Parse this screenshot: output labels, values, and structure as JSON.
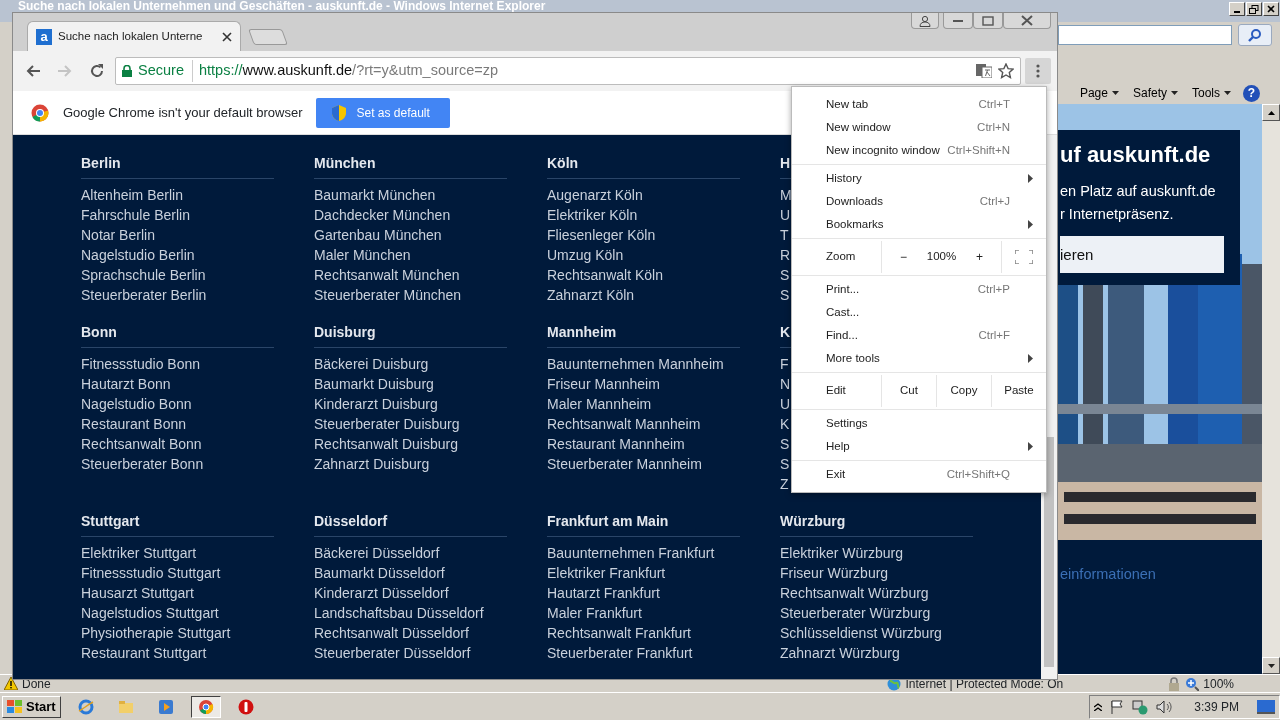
{
  "ie_window": {
    "title": "Suche nach lokalen Unternehmen und Geschäften - auskunft.de - Windows Internet Explorer",
    "command_bar": [
      "Page",
      "Safety",
      "Tools"
    ],
    "help": "?",
    "page": {
      "heading": "uf auskunft.de",
      "text_lines": [
        "en Platz auf auskunft.de",
        "r Internetpräsenz."
      ],
      "button": "ieren",
      "link": "einformationen"
    },
    "status_bar": {
      "text": "Done",
      "zone": "Internet | Protected Mode: On",
      "zoom": "100%"
    }
  },
  "chrome_window": {
    "tab": {
      "favicon_letter": "a",
      "title": "Suche nach lokalen Unterne"
    },
    "address": {
      "security": "Secure",
      "scheme": "https://",
      "host": "www.auskunft.de",
      "path": "/?rt=y&utm_source=zp"
    },
    "infobar": {
      "text": "Google Chrome isn't your default browser",
      "button": "Set as default"
    },
    "cities": [
      {
        "name": "Berlin",
        "links": [
          "Altenheim Berlin",
          "Fahrschule Berlin",
          "Notar Berlin",
          "Nagelstudio Berlin",
          "Sprachschule Berlin",
          "Steuerberater Berlin"
        ]
      },
      {
        "name": "München",
        "links": [
          "Baumarkt München",
          "Dachdecker München",
          "Gartenbau München",
          "Maler München",
          "Rechtsanwalt München",
          "Steuerberater München"
        ]
      },
      {
        "name": "Köln",
        "links": [
          "Augenarzt Köln",
          "Elektriker Köln",
          "Fliesenleger Köln",
          "Umzug Köln",
          "Rechtsanwalt Köln",
          "Zahnarzt Köln"
        ]
      },
      {
        "name": "H",
        "links": [
          "M",
          "U",
          "T",
          "R",
          "S",
          "S"
        ]
      },
      {
        "name": "Bonn",
        "links": [
          "Fitnessstudio Bonn",
          "Hautarzt Bonn",
          "Nagelstudio Bonn",
          "Restaurant Bonn",
          "Rechtsanwalt Bonn",
          "Steuerberater Bonn"
        ]
      },
      {
        "name": "Duisburg",
        "links": [
          "Bäckerei Duisburg",
          "Baumarkt Duisburg",
          "Kinderarzt Duisburg",
          "Steuerberater Duisburg",
          "Rechtsanwalt Duisburg",
          "Zahnarzt Duisburg"
        ]
      },
      {
        "name": "Mannheim",
        "links": [
          "Bauunternehmen Mannheim",
          "Friseur Mannheim",
          "Maler Mannheim",
          "Rechtsanwalt Mannheim",
          "Restaurant Mannheim",
          "Steuerberater Mannheim"
        ]
      },
      {
        "name": "K",
        "links": [
          "F",
          "N",
          "U",
          "K",
          "S",
          "S",
          "Z"
        ]
      },
      {
        "name": "Stuttgart",
        "links": [
          "Elektriker Stuttgart",
          "Fitnessstudio Stuttgart",
          "Hausarzt Stuttgart",
          "Nagelstudios Stuttgart",
          "Physiotherapie Stuttgart",
          "Restaurant Stuttgart"
        ]
      },
      {
        "name": "Düsseldorf",
        "links": [
          "Bäckerei Düsseldorf",
          "Baumarkt Düsseldorf",
          "Kinderarzt Düsseldorf",
          "Landschaftsbau Düsseldorf",
          "Rechtsanwalt Düsseldorf",
          "Steuerberater Düsseldorf"
        ]
      },
      {
        "name": "Frankfurt am Main",
        "links": [
          "Bauunternehmen Frankfurt",
          "Elektriker Frankfurt",
          "Hautarzt Frankfurt",
          "Maler Frankfurt",
          "Rechtsanwalt Frankfurt",
          "Steuerberater Frankfurt"
        ]
      },
      {
        "name": "Würzburg",
        "links": [
          "Elektriker Würzburg",
          "Friseur Würzburg",
          "Rechtsanwalt Würzburg",
          "Steuerberater Würzburg",
          "Schlüsseldienst Würzburg",
          "Zahnarzt Würzburg"
        ]
      }
    ],
    "menu": {
      "sections": [
        [
          {
            "kind": "item",
            "label": "New tab",
            "shortcut": "Ctrl+T",
            "submenu": false
          },
          {
            "kind": "item",
            "label": "New window",
            "shortcut": "Ctrl+N",
            "submenu": false
          },
          {
            "kind": "item",
            "label": "New incognito window",
            "shortcut": "Ctrl+Shift+N",
            "submenu": false
          }
        ],
        [
          {
            "kind": "item",
            "label": "History",
            "submenu": true
          },
          {
            "kind": "item",
            "label": "Downloads",
            "shortcut": "Ctrl+J",
            "submenu": false
          },
          {
            "kind": "item",
            "label": "Bookmarks",
            "submenu": true
          }
        ],
        [
          {
            "kind": "zoom",
            "label": "Zoom",
            "minus": "−",
            "value": "100%",
            "plus": "+"
          }
        ],
        [
          {
            "kind": "item",
            "label": "Print...",
            "shortcut": "Ctrl+P",
            "submenu": false
          },
          {
            "kind": "item",
            "label": "Cast...",
            "submenu": false
          },
          {
            "kind": "item",
            "label": "Find...",
            "shortcut": "Ctrl+F",
            "submenu": false
          },
          {
            "kind": "item",
            "label": "More tools",
            "submenu": true
          }
        ],
        [
          {
            "kind": "edit",
            "label": "Edit",
            "actions": [
              "Cut",
              "Copy",
              "Paste"
            ]
          }
        ],
        [
          {
            "kind": "item",
            "label": "Settings",
            "submenu": false
          },
          {
            "kind": "item",
            "label": "Help",
            "submenu": true
          }
        ],
        [
          {
            "kind": "item",
            "label": "Exit",
            "shortcut": "Ctrl+Shift+Q",
            "submenu": false
          }
        ]
      ]
    }
  },
  "taskbar": {
    "start": "Start",
    "clock": "3:39 PM"
  }
}
